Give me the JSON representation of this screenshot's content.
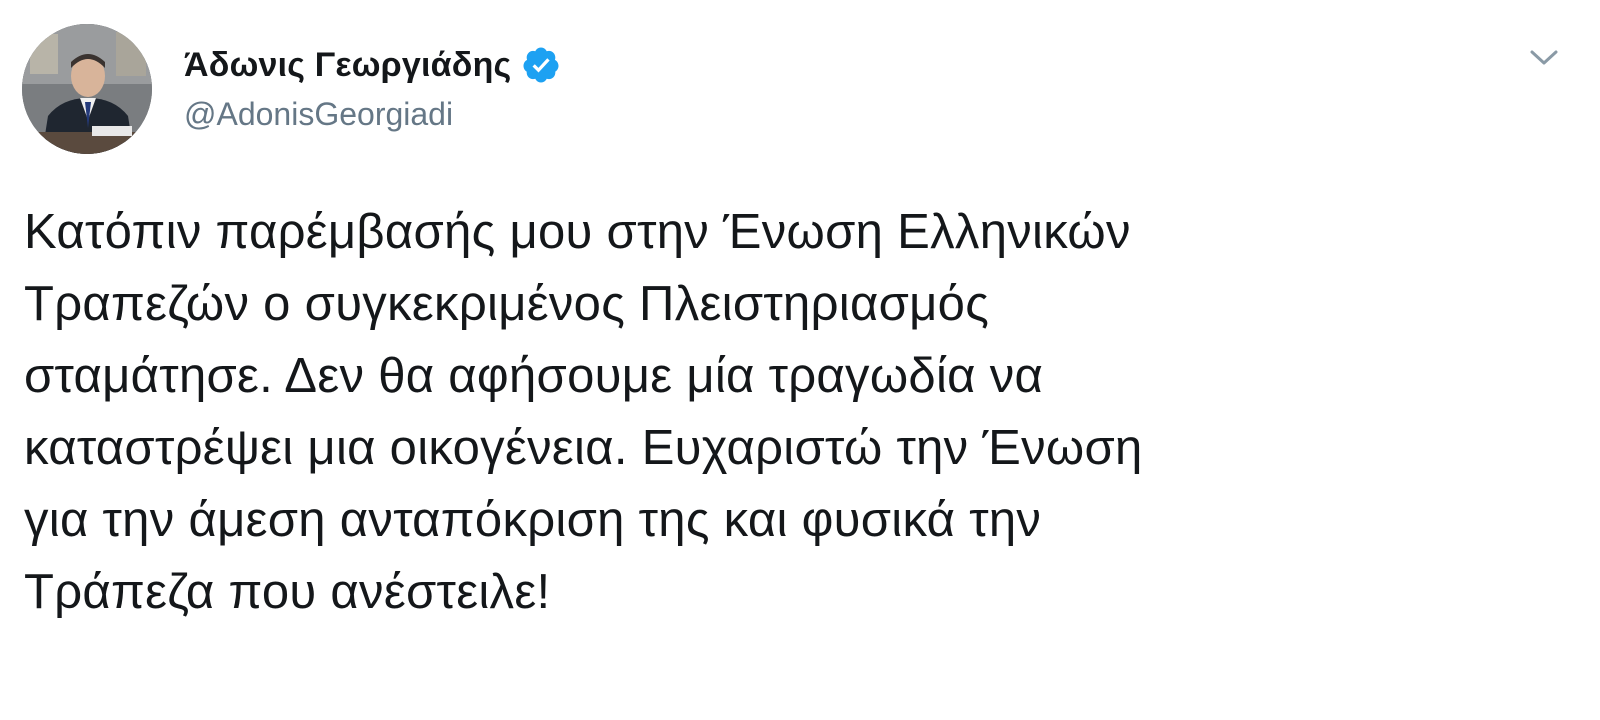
{
  "author": {
    "display_name": "Άδωνις Γεωργιάδης",
    "handle": "@AdonisGeorgiadi",
    "verified": true,
    "avatar_icon": "profile-photo",
    "verified_icon": "verified-badge-icon"
  },
  "menu": {
    "icon": "chevron-down-icon"
  },
  "tweet": {
    "text": "Κατόπιν παρέμβασής μου στην Ένωση Ελληνικών\nΤραπεζών ο συγκεκριμένος Πλειστηριασμός\nσταμάτησε. Δεν θα αφήσουμε μία τραγωδία να\nκαταστρέψει μια οικογένεια. Ευχαριστώ την Ένωση\nγια την άμεση ανταπόκριση της και φυσικά την\nΤράπεζα που ανέστειλε!"
  },
  "colors": {
    "text": "#14171a",
    "secondary": "#657786",
    "verified_blue": "#1da1f2",
    "background": "#ffffff"
  }
}
